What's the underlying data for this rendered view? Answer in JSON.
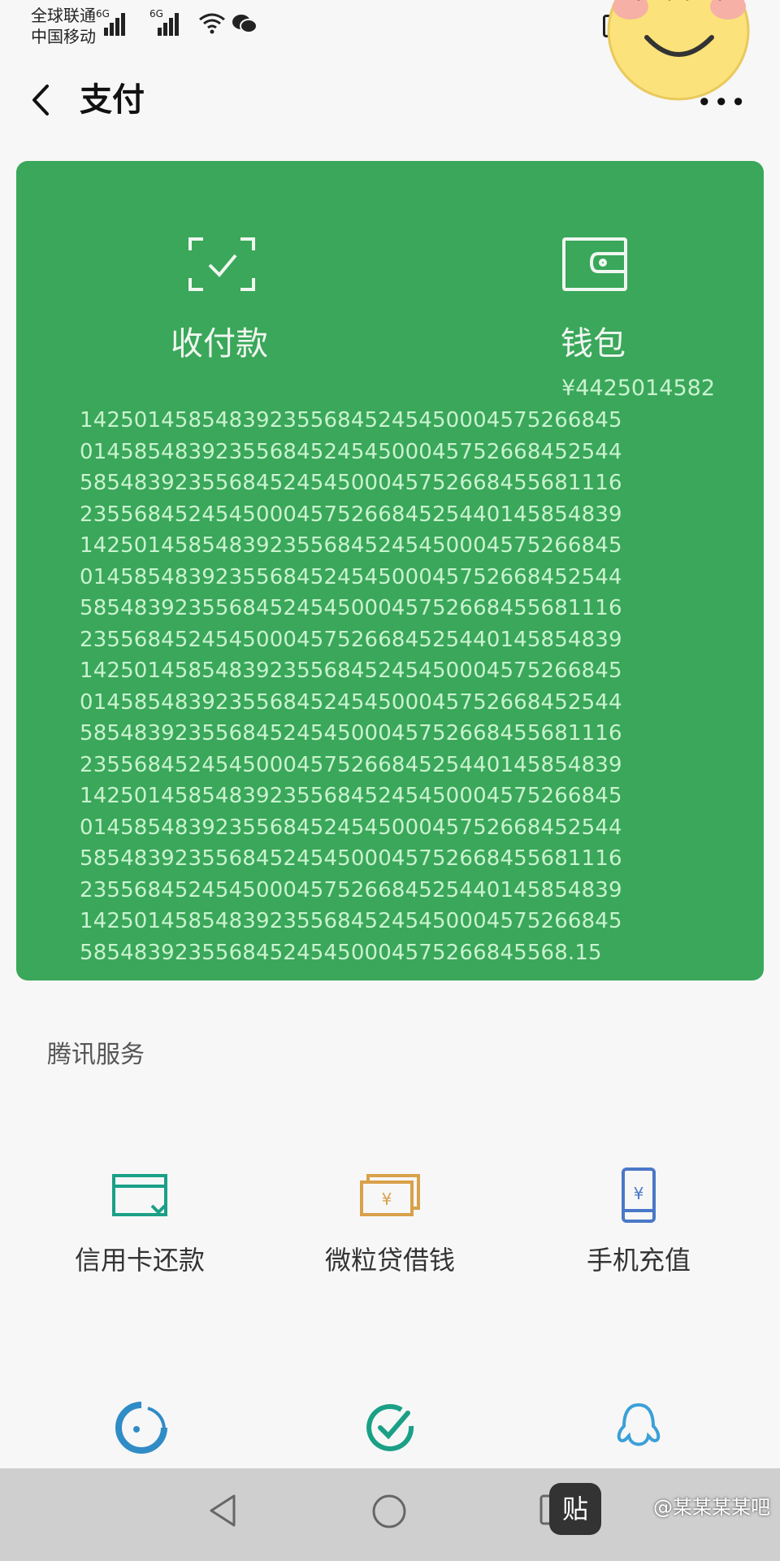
{
  "status_bar": {
    "carrier_1": "全球联通",
    "carrier_2": "中国移动",
    "network_1": "6G",
    "network_2": "6G",
    "icons": [
      "signal-icon",
      "wifi-icon",
      "wechat-icon",
      "battery-icon"
    ]
  },
  "nav": {
    "back_icon": "back-chevron-icon",
    "title": "支付",
    "more_icon": "more-dots-icon"
  },
  "card": {
    "bg_color": "#3aa75a",
    "collect": {
      "label": "收付款",
      "icon": "scan-check-icon"
    },
    "wallet": {
      "label": "钱包",
      "icon": "wallet-icon"
    },
    "balance_lead": "¥4425014582",
    "balance_lines": [
      "14250145854839235568452454500045752668 45",
      "01458548392355684524545000457526684525 44",
      "58548392355684524545000457526684556811 16",
      "23556845245450004575266845254401458548 39",
      "14250145854839235568452454500045752668 45",
      "01458548392355684524545000457526684525 44",
      "58548392355684524545000457526684556811 16",
      "23556845245450004575266845254401458548 39",
      "14250145854839235568452454500045752668 45",
      "01458548392355684524545000457526684525 44",
      "58548392355684524545000457526684556811 16",
      "23556845245450004575266845254401458548 39",
      "14250145854839235568452454500045752668 45",
      "01458548392355684524545000457526684525 44",
      "58548392355684524545000457526684556811 16",
      "23556845245450004575266845254401458548 39",
      "14250145854839235568452454500045752668 45",
      "585483923556845245450004575266845568.15"
    ]
  },
  "tencent_services": {
    "title": "腾讯服务",
    "items": [
      {
        "label": "信用卡还款",
        "icon": "credit-card-icon",
        "color": "#1aa087"
      },
      {
        "label": "微粒贷借钱",
        "icon": "money-bill-icon",
        "color": "#d9a14a"
      },
      {
        "label": "手机充值",
        "icon": "phone-recharge-icon",
        "color": "#4a78c8"
      }
    ],
    "more_icons": [
      {
        "icon": "wealth-icon",
        "color": "#2f8cc6"
      },
      {
        "icon": "check-circle-icon",
        "color": "#1aa087"
      },
      {
        "icon": "qq-icon",
        "color": "#3aa0d8"
      }
    ]
  },
  "system_nav": {
    "icons": [
      "back-triangle-icon",
      "home-circle-icon",
      "recent-square-icon"
    ],
    "watermark_logo": "贴",
    "watermark": "@某某某某吧"
  }
}
